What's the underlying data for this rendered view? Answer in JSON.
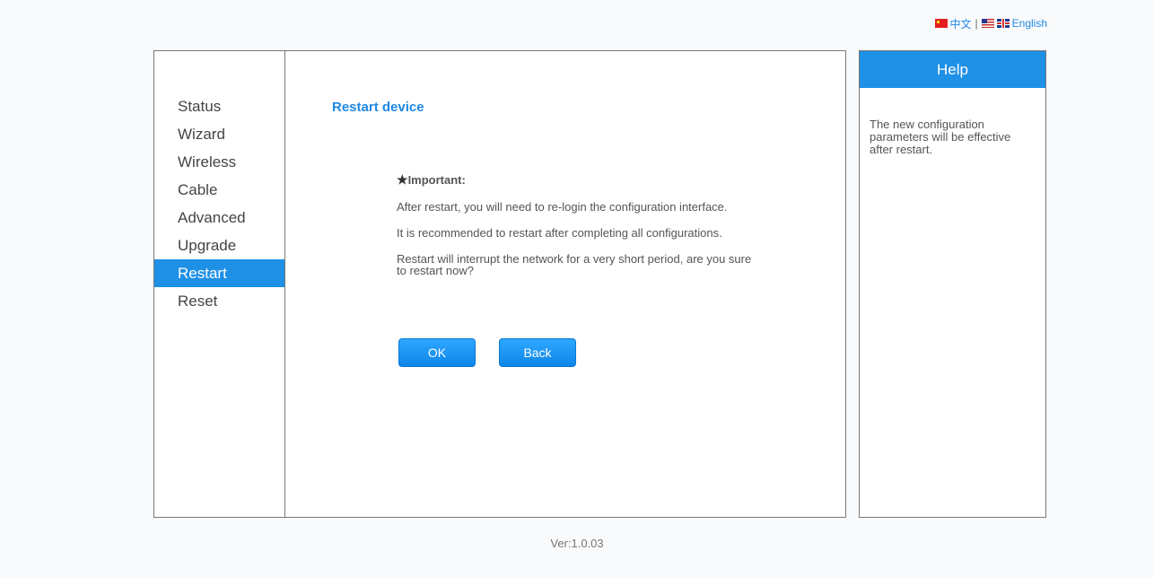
{
  "language_bar": {
    "chinese_label": "中文",
    "separator": "|",
    "english_label": "English"
  },
  "sidebar": {
    "items": [
      {
        "label": "Status"
      },
      {
        "label": "Wizard"
      },
      {
        "label": "Wireless"
      },
      {
        "label": "Cable"
      },
      {
        "label": "Advanced"
      },
      {
        "label": "Upgrade"
      },
      {
        "label": "Restart",
        "active": true
      },
      {
        "label": "Reset"
      }
    ]
  },
  "content": {
    "title": "Restart device",
    "important_label": "Important:",
    "paragraphs": [
      "After restart, you will need to re-login the configuration interface.",
      "It is recommended to restart after completing all configurations.",
      "Restart will interrupt the network for a very short period, are you sure to restart now?"
    ],
    "ok_label": "OK",
    "back_label": "Back"
  },
  "help": {
    "title": "Help",
    "text": "The new configuration parameters will be effective after restart."
  },
  "footer": {
    "version": "Ver:1.0.03"
  },
  "colors": {
    "accent": "#1e90e6",
    "text": "#555555",
    "border": "#777777"
  }
}
